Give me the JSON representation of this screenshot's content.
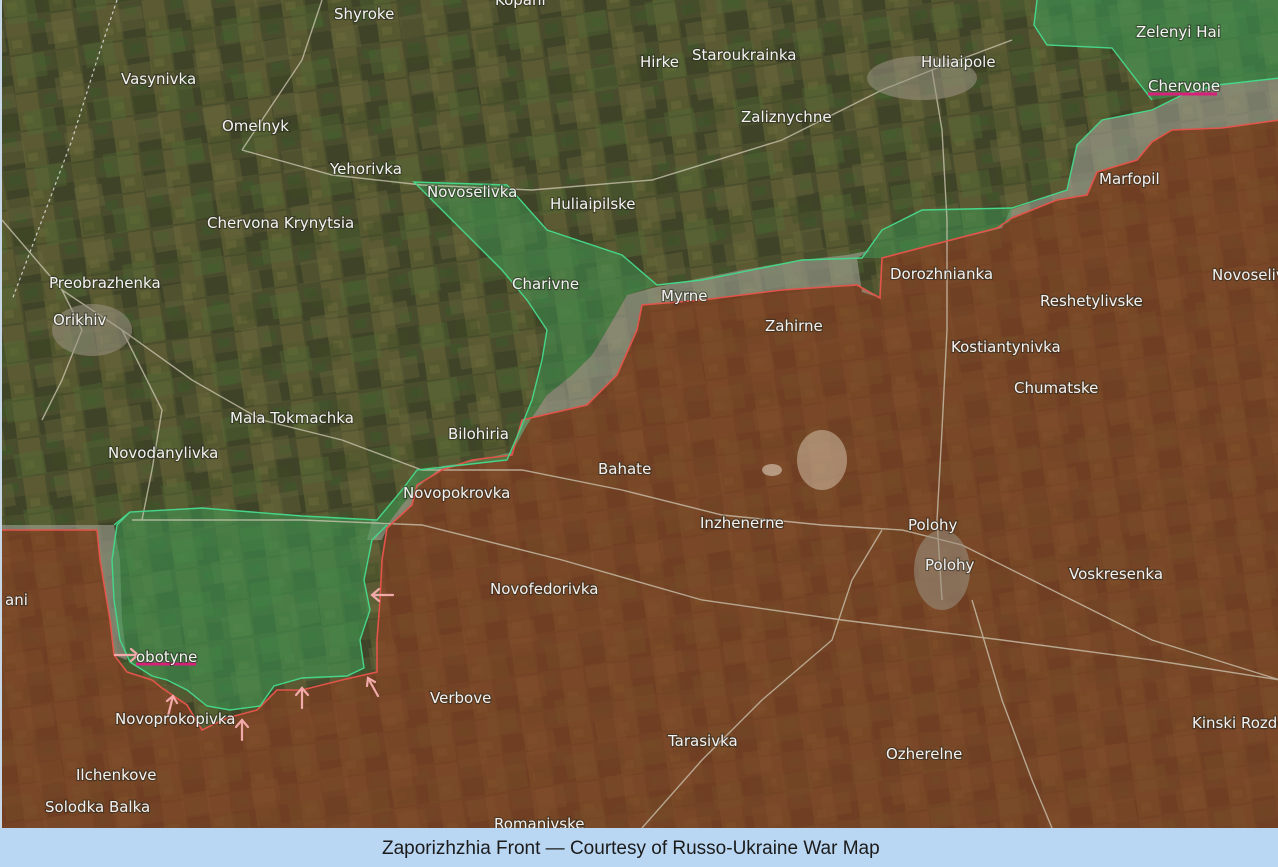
{
  "caption": "Zaporizhzhia Front — Courtesy of Russo-Ukraine War Map",
  "colors": {
    "ukraine_controlled": "#2f7d4a",
    "russia_controlled": "#8b3c26",
    "contested_gray": "#a8a8a0",
    "frontline_red": "#e2544a",
    "frontline_green": "#46d68a",
    "attack_arrow": "#f2a9a9",
    "highlight_underline": "#d8207a"
  },
  "places": {
    "shyroke": "Shyroke",
    "kopani_top": "Kopani",
    "vasynivka": "Vasynivka",
    "hirke": "Hirke",
    "staroukrainka": "Staroukrainka",
    "huliaipole": "Huliaipole",
    "zelenyi_hai": "Zelenyi Hai",
    "chervone": "Chervone",
    "omelnyk": "Omelnyk",
    "zaliznychne": "Zaliznychne",
    "yehorivka": "Yehorivka",
    "marfopil": "Marfopil",
    "novoselivka": "Novoselivka",
    "huliaipilske": "Huliaipilske",
    "chervona_krynytsia": "Chervona Krynytsia",
    "dorozhnianka": "Dorozhnianka",
    "novoselivka_right": "Novoseliv",
    "preobrazhenka": "Preobrazhenka",
    "charivne": "Charivne",
    "myrne": "Myrne",
    "reshetylivske": "Reshetylivske",
    "orikhiv": "Orikhiv",
    "zahirne": "Zahirne",
    "kostiantynivka": "Kostiantynivka",
    "chumatske": "Chumatske",
    "mala_tokmachka": "Mala Tokmachka",
    "bilohiria": "Bilohiria",
    "novodanylivka": "Novodanylivka",
    "bahate": "Bahate",
    "novopokrovka": "Novopokrovka",
    "inzhenerne": "Inzhenerne",
    "polohy": "Polohy",
    "polohy_2": "Polohy",
    "voskresenka": "Voskresenka",
    "novofedorivka": "Novofedorivka",
    "kopani_left": "ani",
    "robotyne": "obotyne",
    "verbove": "Verbove",
    "novoprokopivka": "Novoprokopivka",
    "kinski_rozdory": "Kinski Rozdo",
    "tarasivka": "Tarasivka",
    "ilchenkove": "Ilchenkove",
    "ozherelne": "Ozherelne",
    "solodka_balka": "Solodka Balka",
    "romanivske": "Romanivske"
  }
}
